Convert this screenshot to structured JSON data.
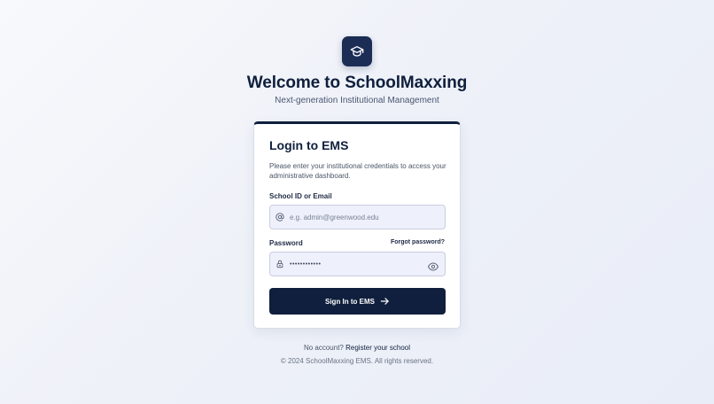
{
  "brand": {
    "logo_icon": "graduation-cap-icon",
    "title": "Welcome to SchoolMaxxing",
    "subtitle": "Next-generation Institutional Management"
  },
  "login_card": {
    "title": "Login to EMS",
    "description": "Please enter your institutional credentials to access your administrative dashboard.",
    "school_id_field": {
      "label": "School ID or Email",
      "placeholder": "e.g. admin@greenwood.edu",
      "value": "",
      "icon": "at-sign-icon"
    },
    "password_field": {
      "label": "Password",
      "value": "••••••••••••",
      "icon": "lock-icon",
      "toggle_icon": "eye-icon"
    },
    "forgot_password_label": "Forgot password?",
    "submit_label": "Sign In to EMS",
    "submit_icon": "arrow-right-icon"
  },
  "footer": {
    "register_prompt": "No account?",
    "register_link": "Register your school",
    "copyright": "© 2024 SchoolMaxxing EMS. All rights reserved."
  },
  "colors": {
    "primary": "#0f1f3d",
    "logo_tile": "#1b2c55",
    "input_background": "#eef0fb",
    "card_background": "#ffffff"
  }
}
